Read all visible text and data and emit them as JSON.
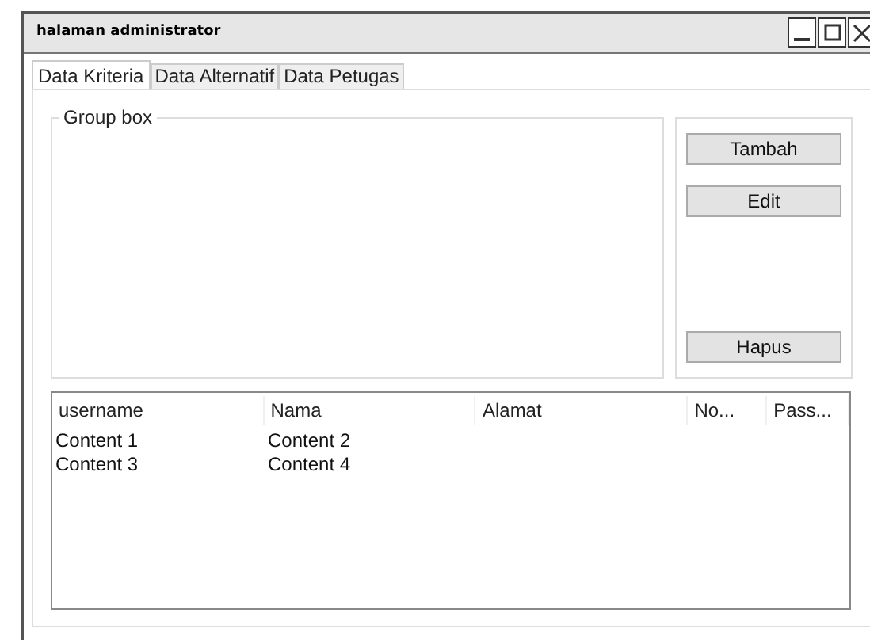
{
  "window": {
    "title": "halaman administrator"
  },
  "tabs": [
    {
      "label": "Data Kriteria",
      "selected": true
    },
    {
      "label": "Data Alternatif",
      "selected": false
    },
    {
      "label": "Data Petugas",
      "selected": false
    }
  ],
  "group_box": {
    "title": "Group box"
  },
  "buttons": [
    {
      "label": "Tambah"
    },
    {
      "label": "Edit"
    },
    {
      "label": "Hapus"
    }
  ],
  "table": {
    "columns": [
      "username",
      "Nama",
      "Alamat",
      "No...",
      "Pass..."
    ],
    "rows": [
      [
        "Content 1",
        "Content 2"
      ],
      [
        "Content 3",
        "Content 4"
      ]
    ]
  }
}
